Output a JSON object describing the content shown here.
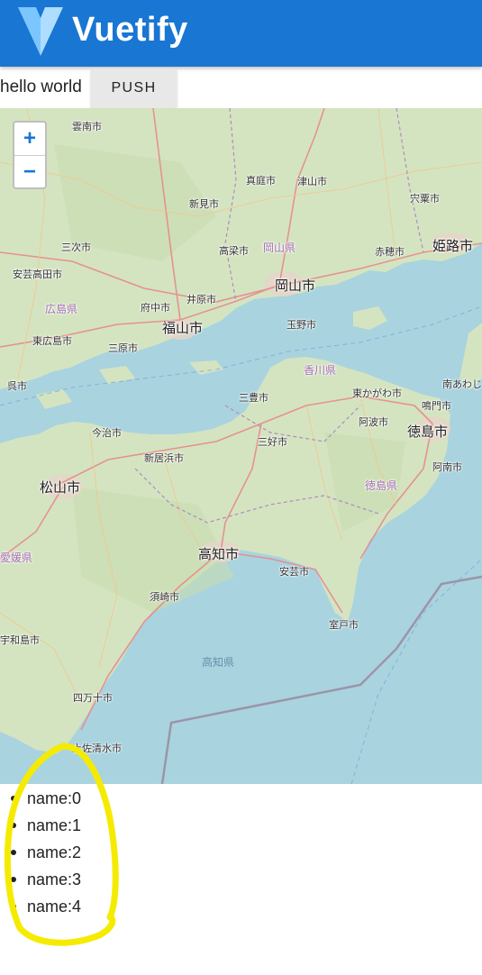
{
  "appbar": {
    "brand": "Vuetify",
    "logo_icon": "vuetify-logo-icon",
    "color": "#1976d2"
  },
  "toolbar": {
    "hello_text": "hello world",
    "push_label": "PUSH"
  },
  "map": {
    "zoom_in_label": "+",
    "zoom_out_label": "−",
    "places": [
      {
        "label": "雲南市",
        "kind": "town"
      },
      {
        "label": "真庭市",
        "kind": "town"
      },
      {
        "label": "津山市",
        "kind": "town"
      },
      {
        "label": "宍粟市",
        "kind": "town"
      },
      {
        "label": "新見市",
        "kind": "town"
      },
      {
        "label": "三次市",
        "kind": "town"
      },
      {
        "label": "高梁市",
        "kind": "town"
      },
      {
        "label": "岡山県",
        "kind": "pref"
      },
      {
        "label": "赤穂市",
        "kind": "town"
      },
      {
        "label": "姫路市",
        "kind": "city"
      },
      {
        "label": "安芸高田市",
        "kind": "town"
      },
      {
        "label": "広島県",
        "kind": "pref"
      },
      {
        "label": "府中市",
        "kind": "town"
      },
      {
        "label": "井原市",
        "kind": "town"
      },
      {
        "label": "岡山市",
        "kind": "city"
      },
      {
        "label": "福山市",
        "kind": "city"
      },
      {
        "label": "玉野市",
        "kind": "town"
      },
      {
        "label": "東広島市",
        "kind": "town"
      },
      {
        "label": "三原市",
        "kind": "town"
      },
      {
        "label": "香川県",
        "kind": "pref"
      },
      {
        "label": "呉市",
        "kind": "town"
      },
      {
        "label": "三豊市",
        "kind": "town"
      },
      {
        "label": "東かがわ市",
        "kind": "town"
      },
      {
        "label": "南あわじ",
        "kind": "town"
      },
      {
        "label": "鳴門市",
        "kind": "town"
      },
      {
        "label": "今治市",
        "kind": "town"
      },
      {
        "label": "阿波市",
        "kind": "town"
      },
      {
        "label": "徳島市",
        "kind": "city"
      },
      {
        "label": "三好市",
        "kind": "town"
      },
      {
        "label": "新居浜市",
        "kind": "town"
      },
      {
        "label": "阿南市",
        "kind": "town"
      },
      {
        "label": "松山市",
        "kind": "city"
      },
      {
        "label": "徳島県",
        "kind": "pref"
      },
      {
        "label": "愛媛県",
        "kind": "pref"
      },
      {
        "label": "高知市",
        "kind": "city"
      },
      {
        "label": "安芸市",
        "kind": "town"
      },
      {
        "label": "須崎市",
        "kind": "town"
      },
      {
        "label": "室戸市",
        "kind": "town"
      },
      {
        "label": "宇和島市",
        "kind": "town"
      },
      {
        "label": "高知県",
        "kind": "sea"
      },
      {
        "label": "四万十市",
        "kind": "town"
      },
      {
        "label": "土佐清水市",
        "kind": "town"
      }
    ]
  },
  "list": {
    "items": [
      "name:0",
      "name:1",
      "name:2",
      "name:3",
      "name:4"
    ]
  },
  "annotation": {
    "color": "#f5eb00"
  }
}
